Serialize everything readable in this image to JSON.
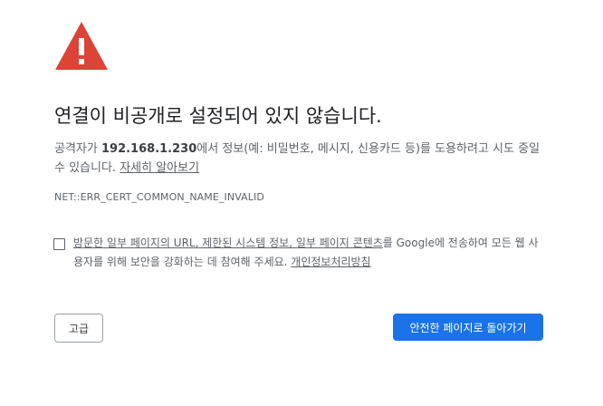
{
  "icon": "warning-triangle-icon",
  "colors": {
    "warning_red": "#db4437",
    "primary_blue": "#1a73e8",
    "text_gray": "#5f6368"
  },
  "heading": "연결이 비공개로 설정되어 있지 않습니다.",
  "description": {
    "prefix": "공격자가 ",
    "host": "192.168.1.230",
    "suffix": "에서 정보(예: 비밀번호, 메시지, 신용카드 등)를 도용하려고 시도 중일 수 있습니다. ",
    "learn_more": "자세히 알아보기"
  },
  "error_code": "NET::ERR_CERT_COMMON_NAME_INVALID",
  "optin": {
    "checked": false,
    "part1": "방문한 일부 페이지의 URL, 제한된 시스템 정보, 일부 페이지 콘텐츠",
    "part2": "를 Google에 전송하여 모든 웹 사용자를 위해 보안을 강화하는 데 참여해 주세요. ",
    "privacy_link": "개인정보처리방침"
  },
  "buttons": {
    "advanced": "고급",
    "back_to_safety": "안전한 페이지로 돌아가기"
  }
}
